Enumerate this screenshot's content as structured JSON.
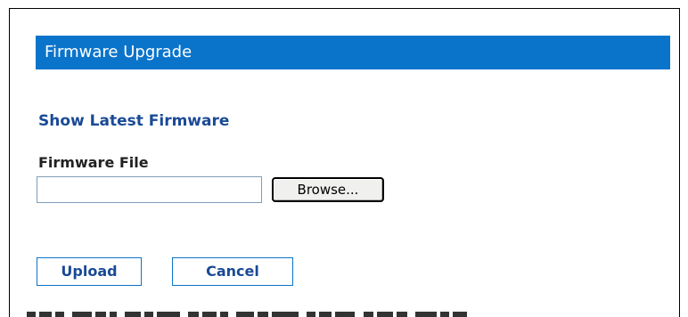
{
  "header": {
    "title": "Firmware Upgrade"
  },
  "links": {
    "show_latest": "Show Latest Firmware"
  },
  "firmware_file": {
    "label": "Firmware File",
    "value": "",
    "browse_label": "Browse..."
  },
  "actions": {
    "upload_label": "Upload",
    "cancel_label": "Cancel"
  },
  "colors": {
    "header_bg": "#0a74cb",
    "link_text": "#1a4a96",
    "button_border": "#0a74cb"
  }
}
